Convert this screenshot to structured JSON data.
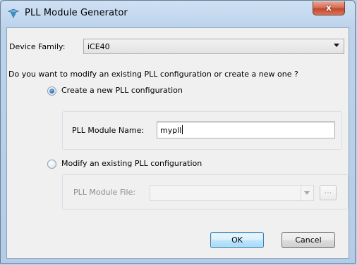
{
  "window": {
    "title": "PLL Module Generator",
    "close_symbol": "x"
  },
  "device_family": {
    "label": "Device Family:",
    "value": "iCE40"
  },
  "question": "Do you want to modify an existing PLL configuration or create a new one ?",
  "create_option": {
    "label": "Create a new PLL configuration",
    "selected": true,
    "name_label": "PLL Module Name:",
    "name_value": "mypll"
  },
  "modify_option": {
    "label": "Modify an existing PLL configuration",
    "selected": false,
    "file_label": "PLL Module File:",
    "file_value": "",
    "browse_label": "..."
  },
  "buttons": {
    "ok": "OK",
    "cancel": "Cancel"
  },
  "icons": {
    "app": "lattice-pll-icon",
    "close": "close-icon"
  },
  "colors": {
    "accent": "#1f5fa8",
    "close": "#c4472d"
  }
}
